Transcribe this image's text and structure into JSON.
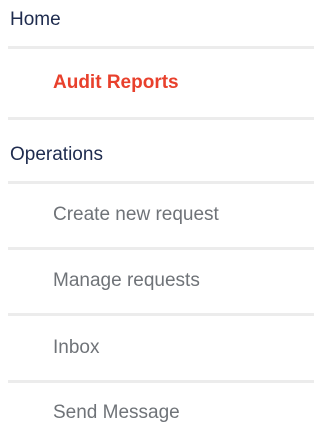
{
  "nav": {
    "home_label": "Home",
    "audit_reports_label": "Audit Reports",
    "operations_label": "Operations",
    "create_request_label": "Create new request",
    "manage_requests_label": "Manage requests",
    "inbox_label": "Inbox",
    "send_message_label": "Send Message"
  },
  "colors": {
    "section_text": "#1e2b4e",
    "active_text": "#e8402c",
    "sub_text": "#6f7378",
    "divider": "#ececec"
  }
}
